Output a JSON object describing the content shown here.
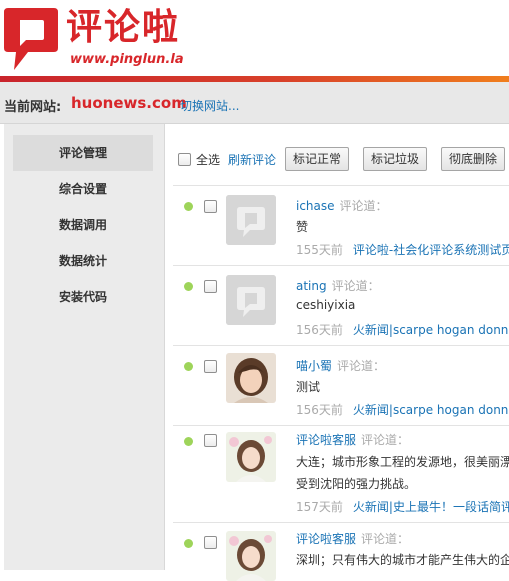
{
  "brand": {
    "name": "评论啦",
    "url": "www.pinglun.la",
    "accent": "#d8262a"
  },
  "sitebar": {
    "label": "当前网站:",
    "site": "huonews.com",
    "switch_label": "切换网站..."
  },
  "sidebar": {
    "items": [
      {
        "label": "评论管理",
        "active": true
      },
      {
        "label": "综合设置"
      },
      {
        "label": "数据调用"
      },
      {
        "label": "数据统计"
      },
      {
        "label": "安装代码"
      }
    ]
  },
  "toolbar": {
    "select_all": "全选",
    "refresh": "刷新评论",
    "mark_normal": "标记正常",
    "mark_spam": "标记垃圾",
    "delete": "彻底删除"
  },
  "comments": [
    {
      "user": "ichase",
      "says": "评论道：",
      "lines": [
        "赞"
      ],
      "time": "155天前",
      "link": "评论啦-社会化评论系统测试页",
      "avatar": "placeholder"
    },
    {
      "user": "ating",
      "says": "评论道：",
      "lines": [
        "ceshiyixia"
      ],
      "time": "156天前",
      "link": "火新闻|scarpe hogan donna",
      "avatar": "placeholder"
    },
    {
      "user": "喵小蜀",
      "says": "评论道：",
      "lines": [
        "测试"
      ],
      "time": "156天前",
      "link": "火新闻|scarpe hogan donna",
      "avatar": "photo-woman"
    },
    {
      "user": "评论啦客服",
      "says": "评论道：",
      "lines": [
        "大连；城市形象工程的发源地，很美丽漂",
        "受到沈阳的强力挑战。"
      ],
      "time": "157天前",
      "link": "火新闻|史上最牛！一段话简评",
      "avatar": "photo-girl"
    },
    {
      "user": "评论啦客服",
      "says": "评论道：",
      "lines": [
        "深圳；只有伟大的城市才能产生伟大的企"
      ],
      "time": "",
      "link": "",
      "avatar": "photo-girl"
    }
  ]
}
